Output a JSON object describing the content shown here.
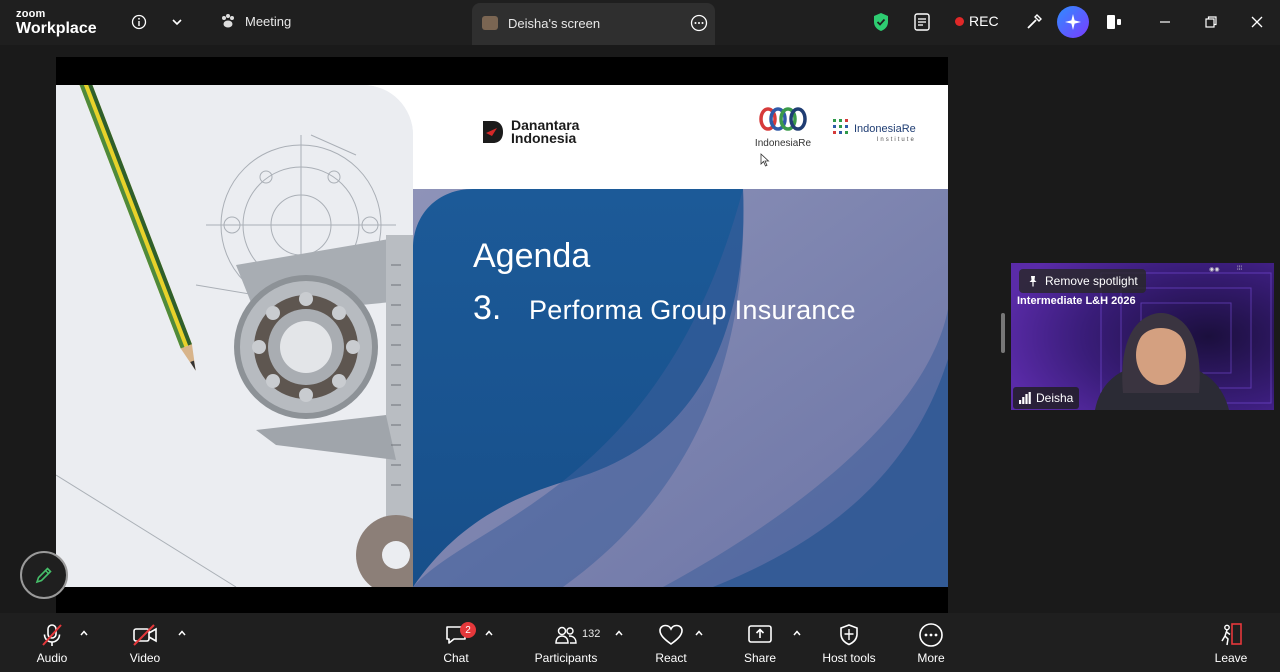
{
  "app": {
    "logo_top": "zoom",
    "logo_bottom": "Workplace"
  },
  "topbar": {
    "meeting_label": "Meeting",
    "screen_tab_label": "Deisha's screen",
    "rec_label": "REC"
  },
  "slide": {
    "brand_left": "Danantara\nIndonesia",
    "brand_mid": "IndonesiaRe",
    "brand_right_main": "IndonesiaRe",
    "brand_right_sub": "Institute",
    "agenda_title": "Agenda",
    "agenda_number": "3.",
    "agenda_item": "Performa Group Insurance"
  },
  "video": {
    "spotlight_label": "Remove spotlight",
    "title": "Intermediate L&H 2026",
    "participant_name": "Deisha"
  },
  "toolbar": {
    "audio": "Audio",
    "video": "Video",
    "chat": "Chat",
    "chat_badge": "2",
    "participants": "Participants",
    "participants_count": "132",
    "react": "React",
    "share": "Share",
    "host_tools": "Host tools",
    "more": "More",
    "leave": "Leave"
  },
  "colors": {
    "bar_bg": "#1f1f1f",
    "app_bg": "#1a1a1a",
    "slide_blue": "#1a5a96",
    "shield_green": "#2ecc71",
    "rec_red": "#e02828",
    "muted_red": "#e5383b"
  }
}
